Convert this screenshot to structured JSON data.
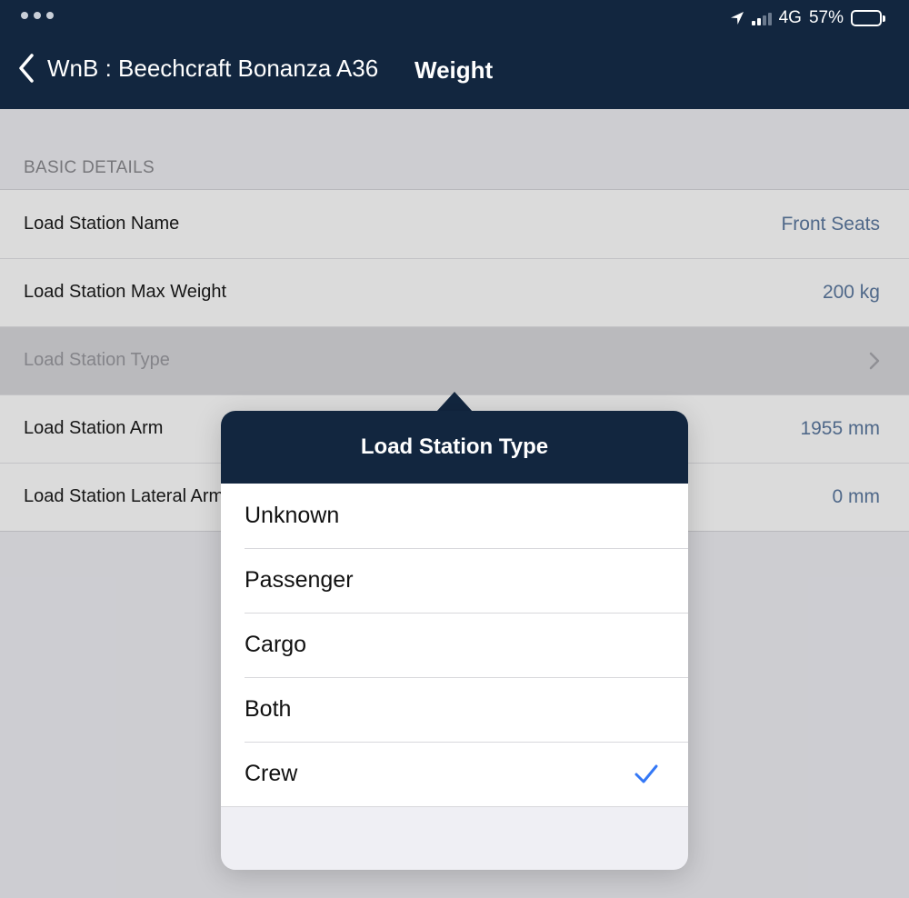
{
  "status_bar": {
    "network": "4G",
    "battery_percent": "57%",
    "battery_level": 0.57
  },
  "nav": {
    "back_label": "WnB : Beechcraft Bonanza A36",
    "title": "Weight"
  },
  "section": {
    "header": "BASIC DETAILS"
  },
  "rows": [
    {
      "label": "Load Station Name",
      "value": "Front Seats"
    },
    {
      "label": "Load Station Max Weight",
      "value": "200 kg"
    },
    {
      "label": "Load Station Type",
      "value": ""
    },
    {
      "label": "Load Station Arm",
      "value": "1955 mm"
    },
    {
      "label": "Load Station Lateral Arm",
      "value": "0 mm"
    }
  ],
  "popover": {
    "title": "Load Station Type",
    "options": [
      {
        "label": "Unknown",
        "selected": false
      },
      {
        "label": "Passenger",
        "selected": false
      },
      {
        "label": "Cargo",
        "selected": false
      },
      {
        "label": "Both",
        "selected": false
      },
      {
        "label": "Crew",
        "selected": true
      }
    ]
  },
  "colors": {
    "nav_background": "#12263f",
    "value_text": "#5d7aa0",
    "checkmark": "#3478f6"
  }
}
